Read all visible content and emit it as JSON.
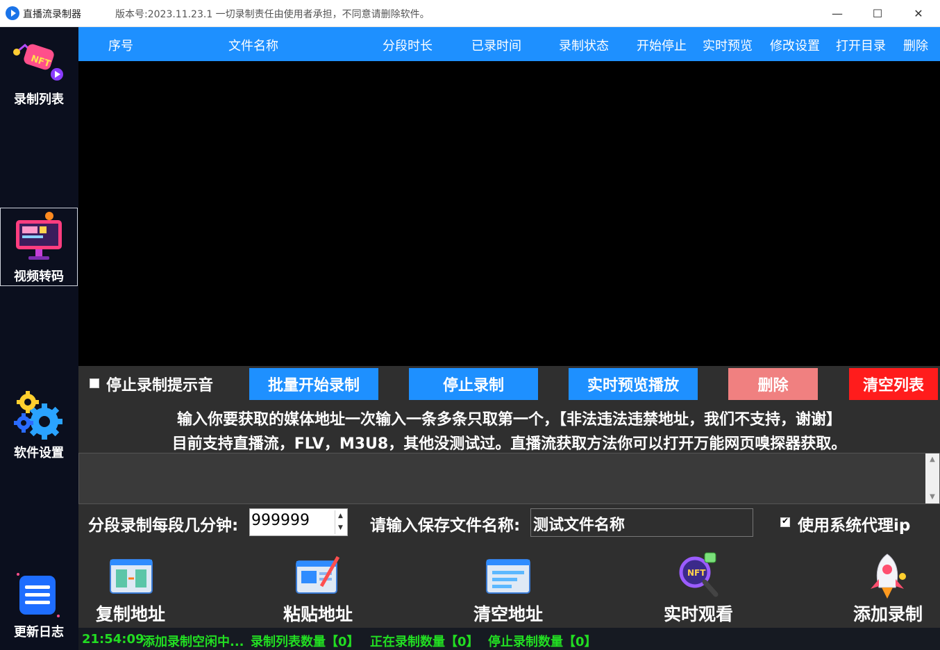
{
  "window": {
    "title": "直播流录制器",
    "version_text": "版本号:2023.11.23.1  一切录制责任由使用者承担，不同意请删除软件。",
    "controls": {
      "minimize": "—",
      "maximize": "☐",
      "close": "✕"
    }
  },
  "sidebar": {
    "items": [
      {
        "label": "录制列表",
        "icon": "nft-record-icon",
        "active": false
      },
      {
        "label": "视频转码",
        "icon": "monitor-transcode-icon",
        "active": true
      },
      {
        "label": "软件设置",
        "icon": "gears-icon",
        "active": false
      },
      {
        "label": "更新日志",
        "icon": "log-list-icon",
        "active": false
      }
    ]
  },
  "table": {
    "columns": [
      "序号",
      "文件名称",
      "分段时长",
      "已录时间",
      "录制状态",
      "开始停止",
      "实时预览",
      "修改设置",
      "打开目录",
      "删除"
    ],
    "rows": []
  },
  "controls": {
    "stop_sound_label": "停止录制提示音",
    "stop_sound_checked": false,
    "buttons": {
      "batch_start": "批量开始录制",
      "stop": "停止录制",
      "preview": "实时预览播放",
      "delete": "删除",
      "clear_list": "清空列表"
    }
  },
  "notice": {
    "line1": "输入你要获取的媒体地址一次输入一条多条只取第一个，【非法违法违禁地址，我们不支持，谢谢】",
    "line2": "目前支持直播流，FLV，M3U8，其他没测试过。直播流获取方法你可以打开万能网页嗅探器获取。"
  },
  "url_input": {
    "value": ""
  },
  "settings": {
    "segment_label": "分段录制每段几分钟:",
    "segment_value": "999999",
    "filename_label": "请输入保存文件名称:",
    "filename_value": "测试文件名称",
    "proxy_label": "使用系统代理ip",
    "proxy_checked": true
  },
  "tools": [
    {
      "label": "复制地址",
      "icon": "copy-address-icon"
    },
    {
      "label": "粘贴地址",
      "icon": "paste-address-icon"
    },
    {
      "label": "清空地址",
      "icon": "clear-address-icon"
    },
    {
      "label": "实时观看",
      "icon": "live-watch-icon"
    },
    {
      "label": "添加录制",
      "icon": "rocket-add-icon"
    }
  ],
  "status": {
    "time": "21:54:09",
    "message": "添加录制空闲中...",
    "list_count": "录制列表数量【0】",
    "recording_count": "正在录制数量【0】",
    "stopped_count": "停止录制数量【0】"
  },
  "colors": {
    "accent_blue": "#1e90ff",
    "sidebar_bg": "#0b0f1e",
    "panel_bg": "#2f2f2f",
    "status_green": "#22dd22",
    "delete_pink": "#f08080",
    "clear_red": "#ff1c1c"
  }
}
